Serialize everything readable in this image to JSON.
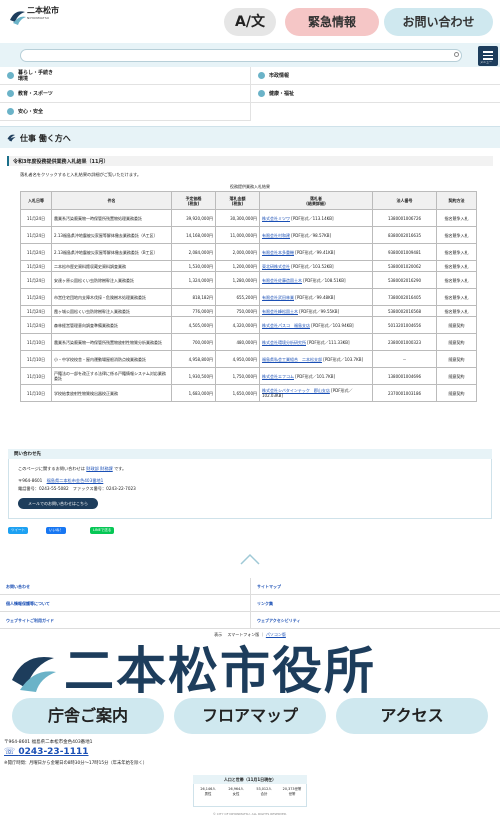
{
  "header": {
    "logo_text": "二本松市",
    "logo_sub": "NIHONMATSU",
    "lang_button": "A/文",
    "emergency_button": "緊急情報",
    "contact_button": "お問い合わせ",
    "menu_label": "メニュー"
  },
  "search": {
    "placeholder": ""
  },
  "categories": [
    {
      "label": "暮らし・手続き\n環境"
    },
    {
      "label": "市政情報"
    },
    {
      "label": "教育・スポーツ"
    },
    {
      "label": "健康・福祉"
    },
    {
      "label": "安心・安全"
    }
  ],
  "section": {
    "title": "仕事 働く方へ"
  },
  "page": {
    "title": "令和3年度役務提供業務入札結果（11月）",
    "intro": "落札者名をクリックすると入札結果の詳細がご覧いただけます。",
    "caption": "役務提供業務入札結果"
  },
  "table": {
    "headers": [
      "入札日等",
      "件名",
      "予定価格\n(税抜)",
      "落札金額\n(税抜)",
      "落札者\n(結果詳細)",
      "法人番号",
      "契約方法"
    ],
    "rows": [
      {
        "date": "11月24日",
        "name": "農業系汚染廃棄物一時保管所残置物処理業務委託",
        "est": "39,920,000円",
        "bid": "30,300,000円",
        "winner": "株式会社ミツワ",
        "file": "[PDF形式／113.14KB]",
        "corp": "1380001006726",
        "method": "指名競争入札"
      },
      {
        "date": "11月24日",
        "name": "2.13福島県沖地震被災家屋等解体撤去業務委託（A工区）",
        "est": "14,168,000円",
        "bid": "11,000,000円",
        "winner": "有限会社村和建",
        "file": "[PDF形式／98.57KB]",
        "corp": "8380002016635",
        "method": "指名競争入札"
      },
      {
        "date": "11月24日",
        "name": "2.13福島県沖地震被災家屋等解体撤去業務委託（B工区）",
        "est": "2,084,000円",
        "bid": "2,000,000円",
        "winner": "有限会社本多重機",
        "file": "[PDF形式／99.41KB]",
        "corp": "9380001009481",
        "method": "指名競争入札"
      },
      {
        "date": "11月24日",
        "name": "二本松市歴史資料館収蔵史資料調査業務",
        "est": "1,530,000円",
        "bid": "1,200,000円",
        "winner": "東北研株式会社",
        "file": "[PDF形式／103.52KB]",
        "corp": "5380001020062",
        "method": "指名競争入札"
      },
      {
        "date": "11月24日",
        "name": "安達ヶ原公園松くい虫防除樹幹注入業務委託",
        "est": "1,324,000円",
        "bid": "1,280,000円",
        "winner": "有限会社佐藤造園土木",
        "file": "[PDF形式／108.51KB]",
        "corp": "5380002016290",
        "method": "指名競争入札"
      },
      {
        "date": "11月24日",
        "name": "市営住宅団地内支障木伐採・危険樹木処理業務委託",
        "est": "818,182円",
        "bid": "655,200円",
        "winner": "有限会社武田林業",
        "file": "[PDF形式／99.48KB]",
        "corp": "7380002016405",
        "method": "指名競争入札"
      },
      {
        "date": "11月24日",
        "name": "霞ヶ城公園松くい虫防除樹幹注入業務委託",
        "est": "776,000円",
        "bid": "750,000円",
        "winner": "有限会社峰松園土木",
        "file": "[PDF形式／99.55KB]",
        "corp": "5380002016568",
        "method": "指名競争入札"
      },
      {
        "date": "11月24日",
        "name": "森林経営管理意向調査準備業務委託",
        "est": "4,505,000円",
        "bid": "4,320,000円",
        "winner": "株式会社パスコ　福島支店",
        "file": "[PDF形式／103.94KB]",
        "corp": "5013201004656",
        "method": "随意契約"
      },
      {
        "date": "11月10日",
        "name": "農業系汚染廃棄物一時保管所残置物放射性物質分析業務委託",
        "est": "700,000円",
        "bid": "480,000円",
        "winner": "株式会社環境分析研究所",
        "file": "[PDF形式／111.33KB]",
        "corp": "2380001000323",
        "method": "随意契約"
      },
      {
        "date": "11月10日",
        "name": "小・中学校校舎・屋内運動場屋根消防点検業務委託",
        "est": "4,958,800円",
        "bid": "4,950,000円",
        "winner": "福島県私会工業組合　二本松支部",
        "file": "[PDF形式／103.7KB]",
        "corp": "－",
        "method": "随意契約"
      },
      {
        "date": "11月10日",
        "name": "戸籍法の一部を改正する法律に係る戸籍情報システム対応業務委託",
        "est": "1,930,500円",
        "bid": "1,750,000円",
        "winner": "株式会社エフコム",
        "file": "[PDF形式／101.7KB]",
        "corp": "1380001004696",
        "method": "随意契約"
      },
      {
        "date": "11月10日",
        "name": "学校給食放射性物質検出器校正業務",
        "est": "1,683,000円",
        "bid": "1,650,000円",
        "winner": "株式会社シバタインテック　郡山支店",
        "file": "[PDF形式／102.03KB]",
        "corp": "2370001003186",
        "method": "随意契約"
      }
    ]
  },
  "inquiry": {
    "title": "問い合わせ先",
    "lead": "このページに関するお問い合わせは",
    "dept": "財政部 財務課",
    "lead_end": "です。",
    "postal": "〒964-8601",
    "address": "福島県二本松市金色403番地1",
    "phone": "電話番号：0243-55-5082　ファックス番号：0243-22-7023",
    "mail_button": "メールでのお問い合わせはこちら"
  },
  "share": {
    "twitter": "ツイート",
    "facebook": "いいね！",
    "line": "LINEで送る"
  },
  "footer_links": [
    {
      "label": "お問い合わせ"
    },
    {
      "label": "サイトマップ"
    },
    {
      "label": "個人情報保護等について"
    },
    {
      "label": "リンク集"
    },
    {
      "label": "ウェブサイトご利用ガイド"
    },
    {
      "label": "ウェブアクセシビリティ"
    }
  ],
  "view_switch": {
    "prefix": "表示",
    "smartphone": "スマートフォン版",
    "sep": "｜",
    "pc": "パソコン版"
  },
  "footer": {
    "city_name": "二本松市役所",
    "buttons": [
      "庁舎ご案内",
      "フロアマップ",
      "アクセス"
    ],
    "address": "〒964-8601 福島県二本松市金色403番地1",
    "tel": "0243-23-1111",
    "hours": "※開庁時間：月曜日から金曜日の8時30分〜17時15分（年末年始を除く）"
  },
  "population": {
    "title": "人口と世帯（11月1日現在）",
    "cells": [
      {
        "value": "26,146人",
        "label": "男性"
      },
      {
        "value": "26,964人",
        "label": "女性"
      },
      {
        "value": "53,012人",
        "label": "合計"
      },
      {
        "value": "20,373世帯",
        "label": "世帯"
      }
    ]
  },
  "copyright": "© CITY OF NIHONMATSU. ALL RIGHTS RESERVED."
}
